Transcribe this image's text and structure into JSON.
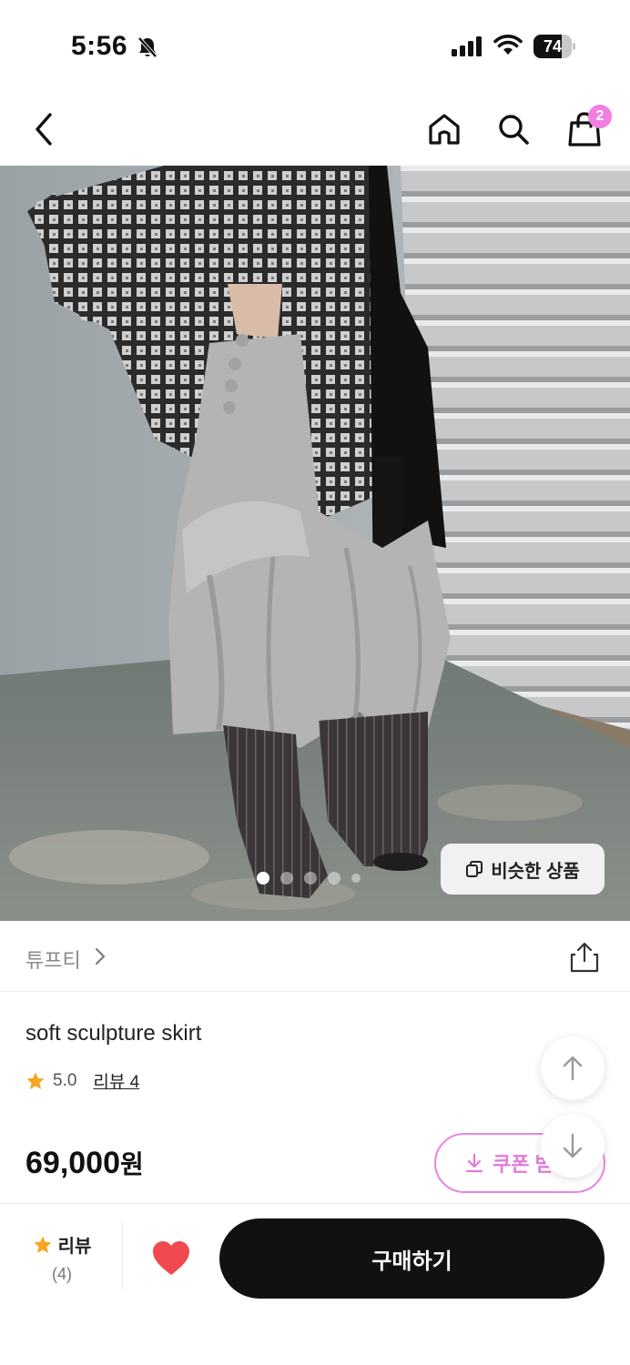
{
  "status_bar": {
    "time": "5:56",
    "battery": "74",
    "battery_level": 0.74
  },
  "nav": {
    "cart_badge": "2"
  },
  "hero": {
    "similar_label": "비슷한 상품",
    "image_count": 5,
    "active_index": 0
  },
  "brand": {
    "name": "튜프티"
  },
  "product": {
    "title": "soft sculpture skirt",
    "rating": "5.0",
    "review_link": "리뷰 4",
    "price": "69,000",
    "price_unit": "원",
    "coupon_label": "쿠폰 받"
  },
  "bottom_bar": {
    "review_label": "리뷰",
    "review_count": "(4)",
    "buy_label": "구매하기"
  },
  "colors": {
    "accent_pink": "#f27ee0",
    "heart_red": "#f04a4f",
    "star_orange": "#f5a623",
    "buy_black": "#111111"
  }
}
